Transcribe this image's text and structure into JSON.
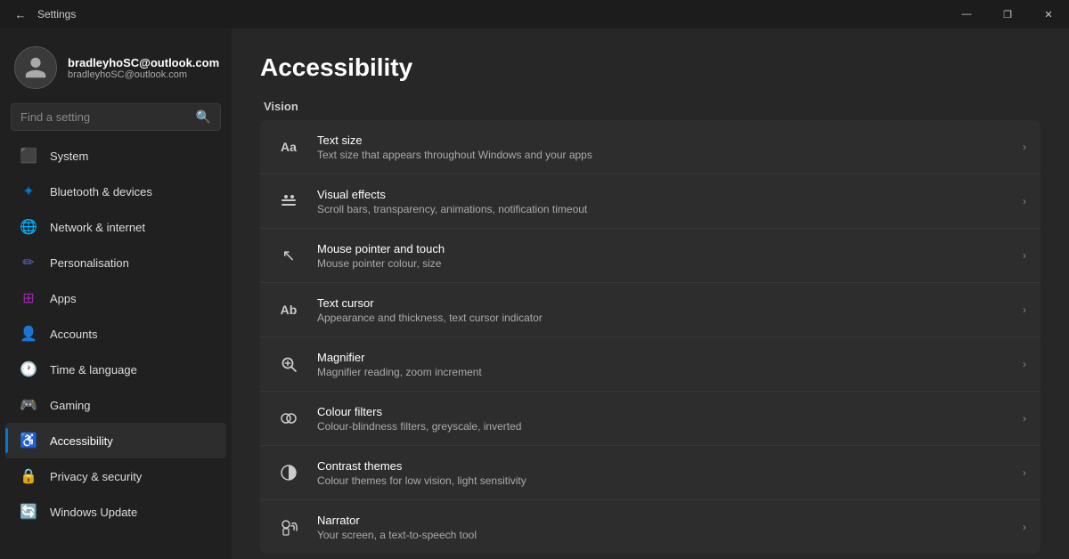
{
  "titlebar": {
    "back_label": "←",
    "title": "Settings",
    "btn_minimize": "—",
    "btn_maximize": "❐",
    "btn_close": "✕"
  },
  "user": {
    "name": "bradleyhoSC@outlook.com",
    "email": "bradleyhoSC@outlook.com"
  },
  "search": {
    "placeholder": "Find a setting"
  },
  "nav": {
    "items": [
      {
        "id": "system",
        "label": "System",
        "icon": "⬛",
        "icon_color": "icon-blue",
        "active": false
      },
      {
        "id": "bluetooth",
        "label": "Bluetooth & devices",
        "icon": "✦",
        "icon_color": "icon-blue",
        "active": false
      },
      {
        "id": "network",
        "label": "Network & internet",
        "icon": "🌐",
        "icon_color": "icon-blue",
        "active": false
      },
      {
        "id": "personalisation",
        "label": "Personalisation",
        "icon": "✏",
        "icon_color": "icon-indigo",
        "active": false
      },
      {
        "id": "apps",
        "label": "Apps",
        "icon": "⊞",
        "icon_color": "icon-purple",
        "active": false
      },
      {
        "id": "accounts",
        "label": "Accounts",
        "icon": "👤",
        "icon_color": "icon-orange",
        "active": false
      },
      {
        "id": "time",
        "label": "Time & language",
        "icon": "🕐",
        "icon_color": "icon-orange",
        "active": false
      },
      {
        "id": "gaming",
        "label": "Gaming",
        "icon": "🎮",
        "icon_color": "icon-pink",
        "active": false
      },
      {
        "id": "accessibility",
        "label": "Accessibility",
        "icon": "♿",
        "icon_color": "icon-cyan",
        "active": true
      },
      {
        "id": "privacy",
        "label": "Privacy & security",
        "icon": "🔒",
        "icon_color": "icon-blue",
        "active": false
      },
      {
        "id": "windows-update",
        "label": "Windows Update",
        "icon": "🔄",
        "icon_color": "icon-blue",
        "active": false
      }
    ]
  },
  "page": {
    "title": "Accessibility",
    "section_vision": "Vision",
    "settings": [
      {
        "id": "text-size",
        "title": "Text size",
        "desc": "Text size that appears throughout Windows and your apps",
        "icon": "Aa"
      },
      {
        "id": "visual-effects",
        "title": "Visual effects",
        "desc": "Scroll bars, transparency, animations, notification timeout",
        "icon": "✧"
      },
      {
        "id": "mouse-pointer",
        "title": "Mouse pointer and touch",
        "desc": "Mouse pointer colour, size",
        "icon": "↖"
      },
      {
        "id": "text-cursor",
        "title": "Text cursor",
        "desc": "Appearance and thickness, text cursor indicator",
        "icon": "Ab"
      },
      {
        "id": "magnifier",
        "title": "Magnifier",
        "desc": "Magnifier reading, zoom increment",
        "icon": "🔍"
      },
      {
        "id": "colour-filters",
        "title": "Colour filters",
        "desc": "Colour-blindness filters, greyscale, inverted",
        "icon": "⬤"
      },
      {
        "id": "contrast-themes",
        "title": "Contrast themes",
        "desc": "Colour themes for low vision, light sensitivity",
        "icon": "◑"
      },
      {
        "id": "narrator",
        "title": "Narrator",
        "desc": "Your screen, a text-to-speech tool",
        "icon": "♪"
      }
    ]
  }
}
